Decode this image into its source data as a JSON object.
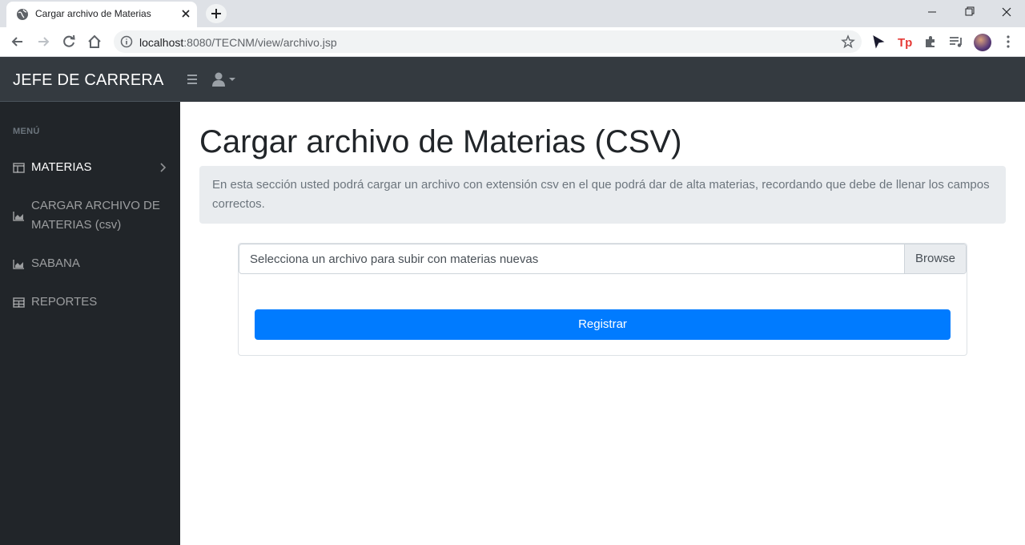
{
  "browser": {
    "tab_title": "Cargar archivo de Materias",
    "url_host": "localhost",
    "url_rest": ":8080/TECNM/view/archivo.jsp"
  },
  "app": {
    "brand": "JEFE DE CARRERA"
  },
  "sidebar": {
    "header": "MENÚ",
    "items": [
      {
        "label": "MATERIAS",
        "icon": "table-columns-icon",
        "active": true
      },
      {
        "label": "CARGAR ARCHIVO DE MATERIAS (csv)",
        "icon": "chart-area-icon"
      },
      {
        "label": "SABANA",
        "icon": "chart-area-icon"
      },
      {
        "label": "REPORTES",
        "icon": "table-icon"
      }
    ]
  },
  "main": {
    "title": "Cargar archivo de Materias (CSV)",
    "info": "En esta sección usted podrá cargar un archivo con extensión csv en el que podrá dar de alta materias, recordando que debe de llenar los campos correctos.",
    "file_placeholder": "Selecciona un archivo para subir con materias nuevas",
    "browse_label": "Browse",
    "submit_label": "Registrar"
  },
  "colors": {
    "navbar": "#343a40",
    "sidebar": "#212529",
    "primary": "#007bff",
    "info_bg": "#e9ecef"
  }
}
